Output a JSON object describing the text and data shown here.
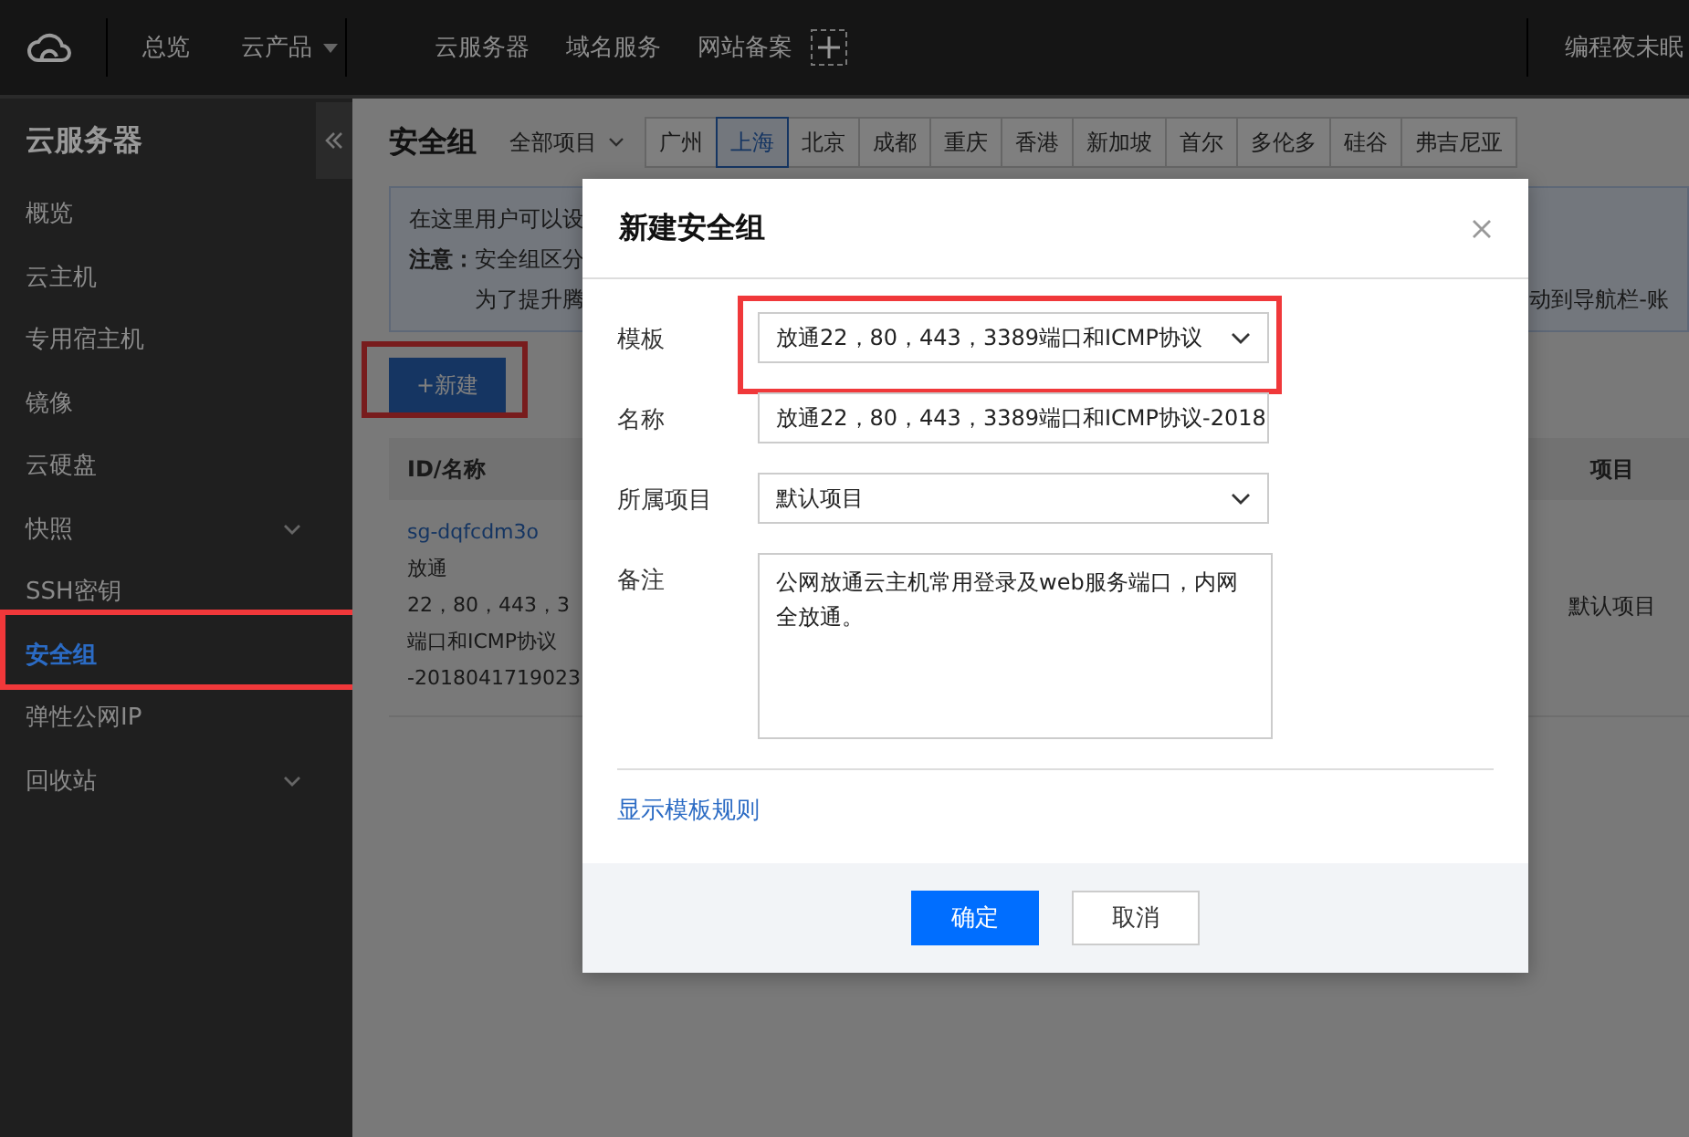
{
  "top_bar": {
    "nav": [
      {
        "label": "总览",
        "dropdown": false
      },
      {
        "label": "云产品",
        "dropdown": true
      }
    ],
    "shortcuts": [
      "云服务器",
      "域名服务",
      "网站备案"
    ],
    "user": "编程夜未眠"
  },
  "sidebar": {
    "title": "云服务器",
    "items": [
      {
        "label": "概览",
        "selected": false,
        "expandable": false,
        "highlighted": false
      },
      {
        "label": "云主机",
        "selected": false,
        "expandable": false,
        "highlighted": false
      },
      {
        "label": "专用宿主机",
        "selected": false,
        "expandable": false,
        "highlighted": false
      },
      {
        "label": "镜像",
        "selected": false,
        "expandable": false,
        "highlighted": false
      },
      {
        "label": "云硬盘",
        "selected": false,
        "expandable": false,
        "highlighted": false
      },
      {
        "label": "快照",
        "selected": false,
        "expandable": true,
        "highlighted": false
      },
      {
        "label": "SSH密钥",
        "selected": false,
        "expandable": false,
        "highlighted": false
      },
      {
        "label": "安全组",
        "selected": true,
        "expandable": false,
        "highlighted": true
      },
      {
        "label": "弹性公网IP",
        "selected": false,
        "expandable": false,
        "highlighted": false
      },
      {
        "label": "回收站",
        "selected": false,
        "expandable": true,
        "highlighted": false
      }
    ]
  },
  "page": {
    "title": "安全组",
    "project_filter": "全部项目",
    "regions": [
      {
        "label": "广州",
        "selected": false
      },
      {
        "label": "上海",
        "selected": true
      },
      {
        "label": "北京",
        "selected": false
      },
      {
        "label": "成都",
        "selected": false
      },
      {
        "label": "重庆",
        "selected": false
      },
      {
        "label": "香港",
        "selected": false
      },
      {
        "label": "新加坡",
        "selected": false
      },
      {
        "label": "首尔",
        "selected": false
      },
      {
        "label": "多伦多",
        "selected": false
      },
      {
        "label": "硅谷",
        "selected": false
      },
      {
        "label": "弗吉尼亚",
        "selected": false
      }
    ],
    "notice": [
      {
        "left": "在这里用户可以设"
      },
      {
        "left": "**注意：**安全组区分"
      },
      {
        "left": "为了提升腾",
        "right": "动到导航栏-账"
      }
    ],
    "new_button": {
      "label": "+新建",
      "highlighted": true
    },
    "table": {
      "columns": [
        "ID/名称",
        "项目"
      ],
      "rows": [
        {
          "id": "sg-dqfcdm3o",
          "name_lines": [
            "放通",
            "22，80，443，3",
            "端口和ICMP协议",
            "-2018041719023"
          ],
          "project": "默认项目"
        }
      ]
    }
  },
  "dialog": {
    "title": "新建安全组",
    "fields": [
      {
        "label": "模板",
        "kind": "select",
        "value": "放通22，80，443，3389端口和ICMP协议",
        "highlighted": true
      },
      {
        "label": "名称",
        "kind": "text",
        "value": "放通22，80，443，3389端口和ICMP协议-2018"
      },
      {
        "label": "所属项目",
        "kind": "select",
        "value": "默认项目"
      },
      {
        "label": "备注",
        "kind": "textarea",
        "value": "公网放通云主机常用登录及web服务端口，内网全放通。"
      }
    ],
    "link": "显示模板规则",
    "buttons": [
      {
        "label": "确定",
        "primary": true
      },
      {
        "label": "取消",
        "primary": false
      }
    ]
  }
}
